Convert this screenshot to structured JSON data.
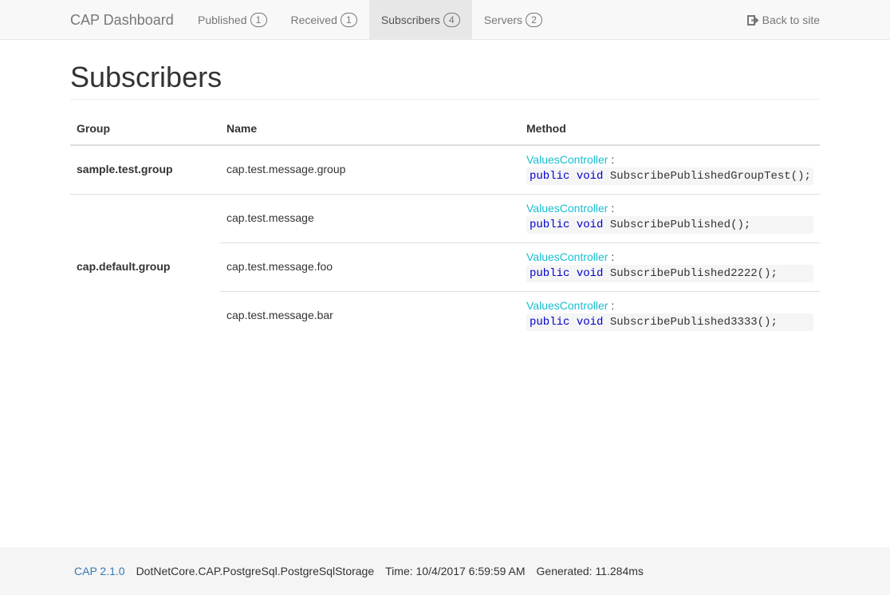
{
  "navbar": {
    "brand": "CAP Dashboard",
    "items": [
      {
        "label": "Published",
        "count": "1"
      },
      {
        "label": "Received",
        "count": "1"
      },
      {
        "label": "Subscribers",
        "count": "4",
        "active": true
      },
      {
        "label": "Servers",
        "count": "2"
      }
    ],
    "back_label": "Back to site",
    "back_icon": "sign-out-icon"
  },
  "page": {
    "title": "Subscribers"
  },
  "table": {
    "headers": {
      "group": "Group",
      "name": "Name",
      "method": "Method"
    },
    "groups": [
      {
        "group": "sample.test.group",
        "rows": [
          {
            "name": "cap.test.message.group",
            "controller": "ValuesController",
            "colon": ":",
            "kw1": "public",
            "kw2": "void",
            "sig": "SubscribePublishedGroupTest();"
          }
        ]
      },
      {
        "group": "cap.default.group",
        "rows": [
          {
            "name": "cap.test.message",
            "controller": "ValuesController",
            "colon": ":",
            "kw1": "public",
            "kw2": "void",
            "sig": "SubscribePublished();"
          },
          {
            "name": "cap.test.message.foo",
            "controller": "ValuesController",
            "colon": ":",
            "kw1": "public",
            "kw2": "void",
            "sig": "SubscribePublished2222();"
          },
          {
            "name": "cap.test.message.bar",
            "controller": "ValuesController",
            "colon": ":",
            "kw1": "public",
            "kw2": "void",
            "sig": "SubscribePublished3333();"
          }
        ]
      }
    ]
  },
  "footer": {
    "version": "CAP 2.1.0",
    "storage": "DotNetCore.CAP.PostgreSql.PostgreSqlStorage",
    "time": "Time: 10/4/2017 6:59:59 AM",
    "generated": "Generated: 11.284ms"
  },
  "colors": {
    "controller": "#17becf",
    "keyword": "#0000cc",
    "link": "#337ab7"
  }
}
